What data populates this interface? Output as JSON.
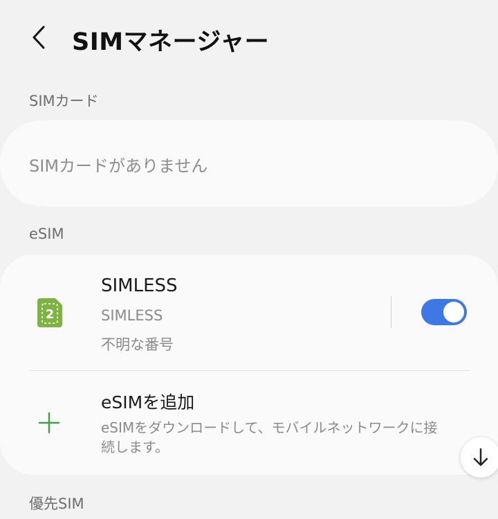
{
  "header": {
    "title": "SIMマネージャー",
    "back_icon": "chevron-left-icon"
  },
  "sections": {
    "sim_card": {
      "label": "SIMカード",
      "empty_text": "SIMカードがありません"
    },
    "esim": {
      "label": "eSIM",
      "profile": {
        "icon": "sim-card-2-icon",
        "icon_badge": "2",
        "name": "SIMLESS",
        "carrier": "SIMLESS",
        "number": "不明な番号",
        "enabled": true
      },
      "add": {
        "icon": "plus-icon",
        "title": "eSIMを追加",
        "description": "eSIMをダウンロードして、モバイルネットワークに接続します。"
      }
    },
    "preferred": {
      "label": "優先SIM"
    }
  },
  "scroll_button": {
    "icon": "arrow-down-icon"
  },
  "colors": {
    "background": "#f2f2f2",
    "card": "#fafafa",
    "toggle_on": "#3e78e6",
    "sim_icon": "#7cb342",
    "plus_icon": "#43a047"
  }
}
